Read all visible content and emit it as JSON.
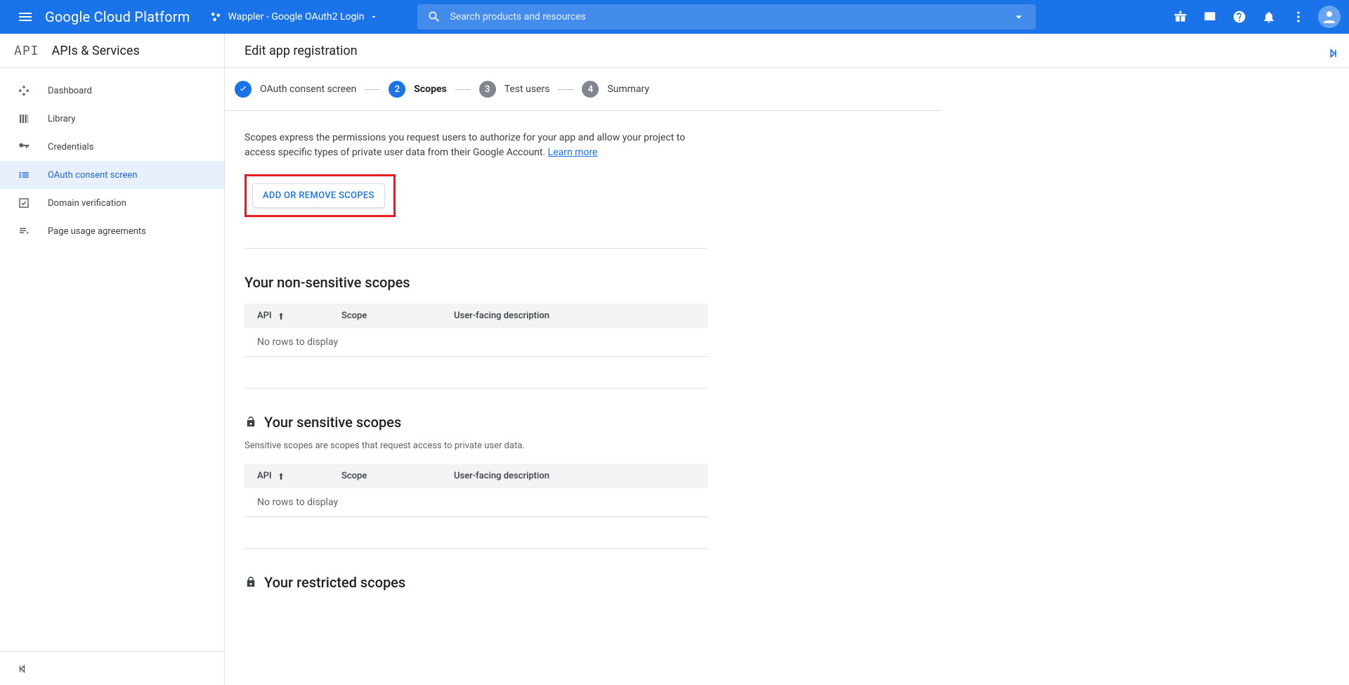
{
  "topbar": {
    "logo_google": "Google",
    "logo_cp": " Cloud Platform",
    "project_name": "Wappler - Google OAuth2 Login",
    "search_placeholder": "Search products and resources"
  },
  "side": {
    "api_badge": "API",
    "title": "APIs & Services",
    "items": [
      {
        "label": "Dashboard"
      },
      {
        "label": "Library"
      },
      {
        "label": "Credentials"
      },
      {
        "label": "OAuth consent screen"
      },
      {
        "label": "Domain verification"
      },
      {
        "label": "Page usage agreements"
      }
    ]
  },
  "main": {
    "title": "Edit app registration",
    "steps": [
      {
        "label": "OAuth consent screen",
        "state": "done"
      },
      {
        "num": "2",
        "label": "Scopes",
        "state": "cur"
      },
      {
        "num": "3",
        "label": "Test users",
        "state": "todo"
      },
      {
        "num": "4",
        "label": "Summary",
        "state": "todo"
      }
    ],
    "intro_text": "Scopes express the permissions you request users to authorize for your app and allow your project to access specific types of private user data from their Google Account. ",
    "learn_more": "Learn more",
    "add_scopes_button": "ADD OR REMOVE SCOPES",
    "table_headers": {
      "api": "API",
      "scope": "Scope",
      "desc": "User-facing description"
    },
    "empty_row": "No rows to display",
    "non_sensitive_title": "Your non-sensitive scopes",
    "sensitive_title": "Your sensitive scopes",
    "sensitive_sub": "Sensitive scopes are scopes that request access to private user data.",
    "restricted_title": "Your restricted scopes"
  }
}
